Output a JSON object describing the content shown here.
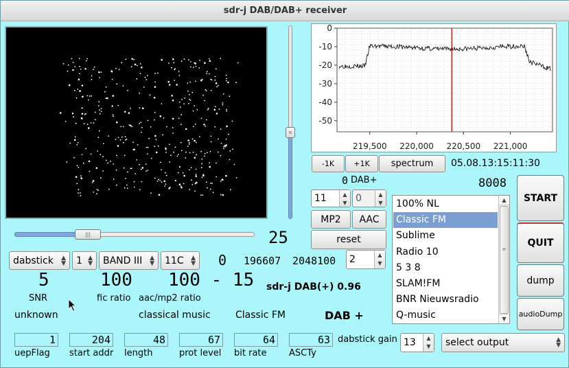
{
  "window": {
    "title": "sdr-j DAB/DAB+ receiver"
  },
  "spectrum": {
    "y_ticks": [
      "0",
      "-10",
      "-20",
      "-30",
      "-40",
      "-50"
    ],
    "x_ticks": [
      "219,500",
      "220,000",
      "220,500",
      "221,000"
    ],
    "marker_color": "#d60000"
  },
  "tuning": {
    "minus_1k": "-1K",
    "plus_1k": "+1K",
    "spectrum_button": "spectrum",
    "timestamp": "05.08.13:15:11:30"
  },
  "ensemble": {
    "lcd_left": "0",
    "dab_label": "DAB+",
    "lcd_right": "8008"
  },
  "spins": {
    "left_value": "11",
    "right_value": "0",
    "subchannel_value": "2",
    "gain_value": "13"
  },
  "buttons": {
    "mp2": "MP2",
    "aac": "AAC",
    "reset": "reset",
    "start": "START",
    "quit": "QUIT",
    "dump": "dump",
    "audio_dump": "audioDump"
  },
  "stations": [
    "100% NL",
    "Classic FM",
    "Sublime",
    "Radio 10",
    "5 3 8",
    "SLAM!FM",
    "BNR Nieuwsradio",
    "Q-music"
  ],
  "selected_station_index": 1,
  "controls": {
    "device": "dabstick",
    "mode": "1",
    "band": "BAND III",
    "channel": "11C",
    "slider_lcd": "25"
  },
  "readouts": {
    "offset": "0",
    "freq": "196607",
    "rate": "2048100"
  },
  "metrics": {
    "snr": "5",
    "snr_label": "SNR",
    "fic": "100",
    "fic_label": "fic ratio",
    "aac_ratio": "100 - 15",
    "aac_label": "aac/mp2 ratio"
  },
  "version": "sdr-j DAB(+)  0.96",
  "status": {
    "state": "unknown",
    "genre": "classical music",
    "station": "Classic FM",
    "type": "DAB +"
  },
  "fields": [
    {
      "value": "1",
      "label": "uepFlag"
    },
    {
      "value": "204",
      "label": "start addr"
    },
    {
      "value": "48",
      "label": "length"
    },
    {
      "value": "67",
      "label": "prot level"
    },
    {
      "value": "64",
      "label": "bit rate"
    },
    {
      "value": "63",
      "label": "ASCTy"
    }
  ],
  "gain_label": "dabstick gain",
  "output_select": "select output"
}
